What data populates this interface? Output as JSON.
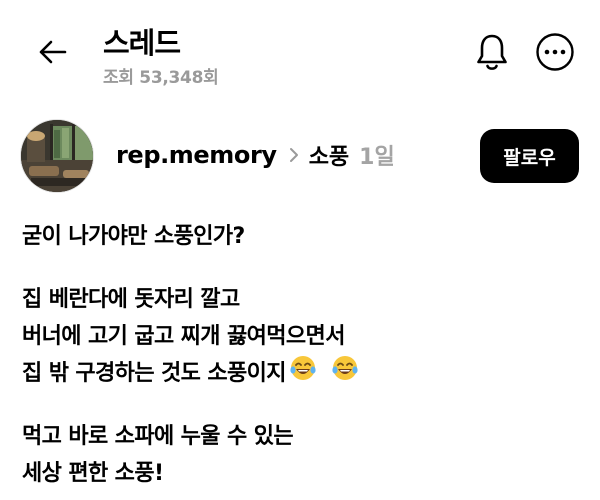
{
  "header": {
    "title": "스레드",
    "views": "조회 53,348회",
    "back_icon": "arrow-left-icon",
    "bell_icon": "bell-icon",
    "more_icon": "more-horizontal-icon"
  },
  "author": {
    "username": "rep.memory",
    "topic": "소풍",
    "age": "1일",
    "follow_label": "팔로우"
  },
  "post": {
    "paragraphs": [
      [
        "굳이 나가야만 소풍인가?"
      ],
      [
        "집 베란다에 돗자리 깔고",
        "버너에 고기 굽고 찌개 끓여먹으면서",
        "집 밖 구경하는 것도 소풍이지"
      ],
      [
        "먹고 바로 소파에 누울 수 있는",
        "세상 편한 소풍!"
      ]
    ],
    "line_emojis": [
      "face-with-tears-of-joy-emoji",
      "face-with-tears-of-joy-emoji"
    ]
  },
  "colors": {
    "text": "#000000",
    "muted": "#9a9a9a",
    "button_bg": "#000000",
    "button_text": "#ffffff"
  }
}
